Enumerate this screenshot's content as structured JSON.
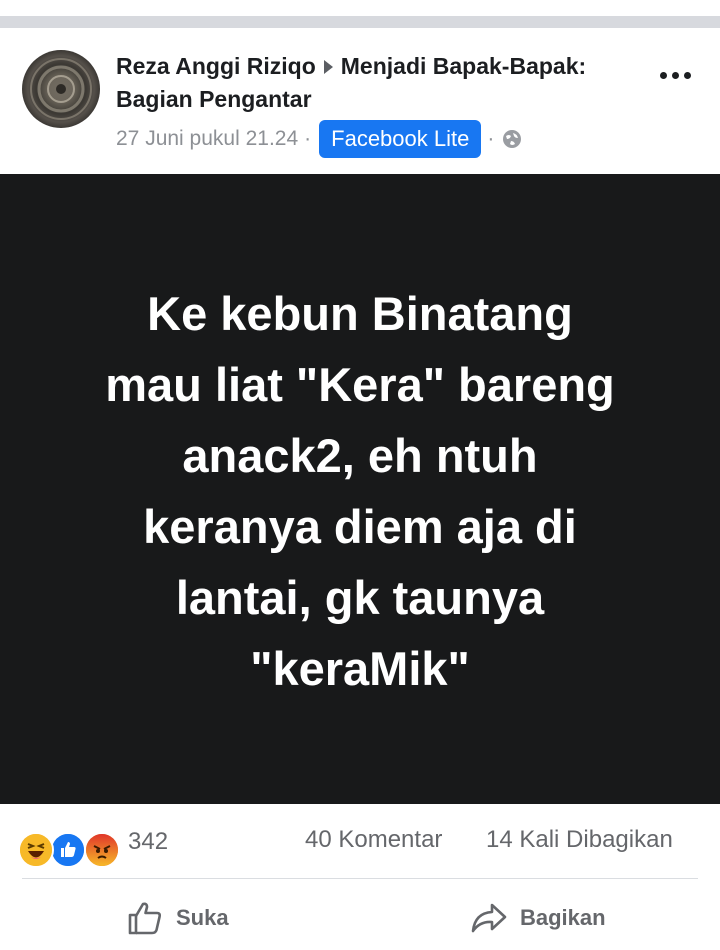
{
  "post": {
    "author": "Reza Anggi Riziqo",
    "group": "Menjadi Bapak-Bapak: Bagian Pengantar",
    "timestamp": "27 Juni pukul 21.24",
    "separator": "·",
    "app_badge": "Facebook Lite",
    "privacy_icon": "globe-icon",
    "text": "Ke kebun Binatang\nmau liat \"Kera\" bareng\nanack2, eh ntuh\nkeranya diem aja di\nlantai, gk taunya\n\"keraMik\"",
    "background_color": "#18191a",
    "text_color": "#ffffff"
  },
  "stats": {
    "reactions": [
      "haha",
      "like",
      "angry"
    ],
    "reaction_count": "342",
    "comments": "40 Komentar",
    "shares": "14 Kali Dibagikan"
  },
  "actions": {
    "like_label": "Suka",
    "share_label": "Bagikan"
  },
  "colors": {
    "accent": "#1877f2",
    "secondary_text": "#65676b"
  }
}
